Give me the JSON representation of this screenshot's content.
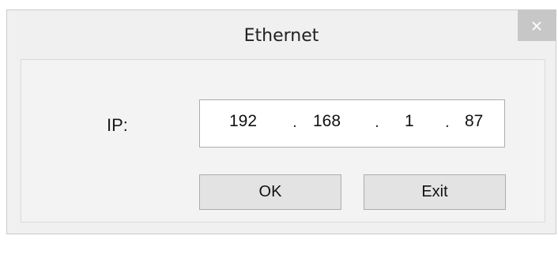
{
  "window": {
    "title": "Ethernet",
    "close_icon": "close-icon"
  },
  "form": {
    "ip_label": "IP:",
    "ip_octets": [
      "192",
      "168",
      "1",
      "87"
    ],
    "separator": "."
  },
  "buttons": {
    "ok_label": "OK",
    "exit_label": "Exit"
  },
  "colors": {
    "dialog_background": "#f0f0f0",
    "close_button": "#c7c7c7",
    "button_face": "#e3e3e3"
  }
}
